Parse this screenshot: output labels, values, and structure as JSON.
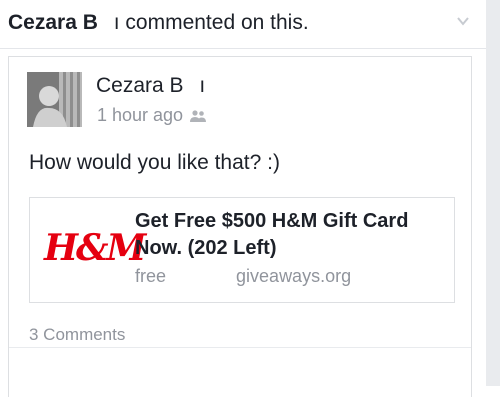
{
  "header": {
    "actor_name": "Cezara B",
    "actor_initial": "ı",
    "action_text": " commented on this."
  },
  "post": {
    "author": "Cezara B",
    "author_initial": "ı",
    "timestamp": "1 hour ago",
    "audience_icon": "friends-icon",
    "text": "How would you like that? :)"
  },
  "link": {
    "brand_text": "H&M",
    "title": "Get Free $500 H&M Gift Card Now. (202 Left)",
    "domain_left": "free",
    "domain_right": "giveaways.org"
  },
  "footer": {
    "comments_label": "3 Comments"
  },
  "colors": {
    "brand_red": "#e50010",
    "muted_text": "#90949c",
    "border": "#dddfe2"
  }
}
